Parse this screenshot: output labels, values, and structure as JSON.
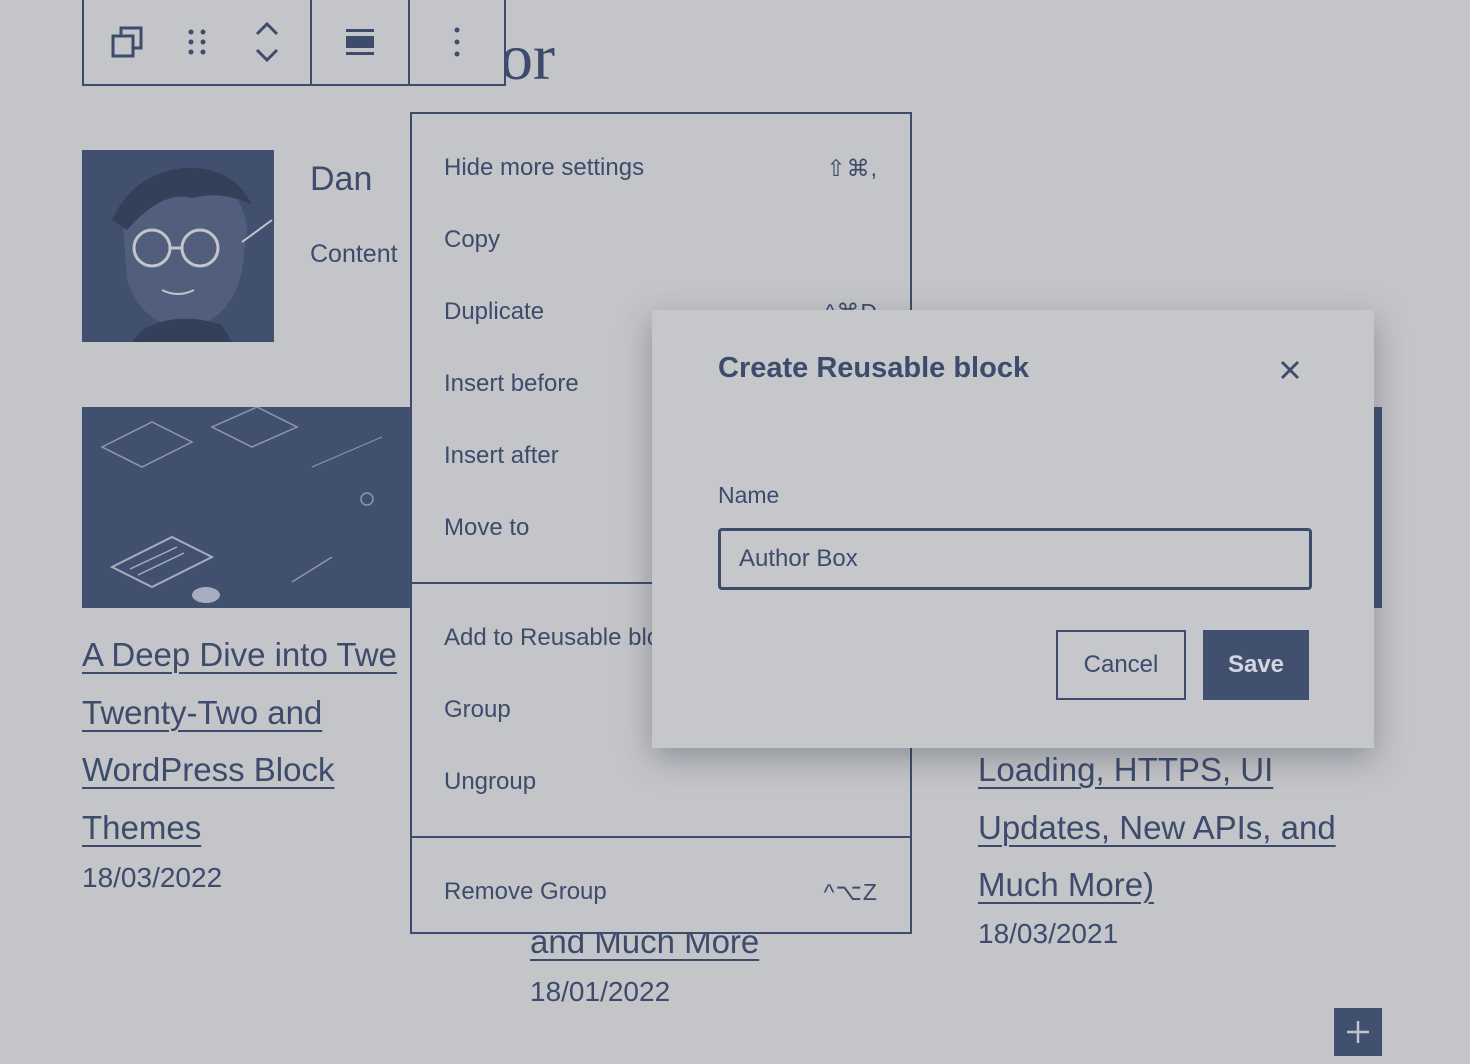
{
  "toolbar": {
    "transform_icon": "copy-squares-icon",
    "drag_icon": "drag-handle-icon",
    "move_icon": "chevron-up-down-icon",
    "align_icon": "align-justify-icon",
    "options_icon": "more-vertical-icon"
  },
  "page": {
    "heading_fragment": "or",
    "author": {
      "name": "Dan",
      "bio": "Content"
    },
    "posts": [
      {
        "title_lines": [
          "A Deep Dive into Twe",
          "Twenty-Two and",
          "WordPress Block",
          "Themes"
        ],
        "date": "18/03/2022"
      },
      {
        "title_lines": [
          "and Much More"
        ],
        "date": "18/01/2022"
      },
      {
        "title_lines": [
          "Loading, HTTPS, UI",
          "Updates, New APIs, and",
          "Much More)"
        ],
        "date": "18/03/2021"
      }
    ]
  },
  "menu": {
    "sections": [
      {
        "items": [
          {
            "label": "Hide more settings",
            "shortcut": "⇧⌘,"
          },
          {
            "label": "Copy",
            "shortcut": ""
          },
          {
            "label": "Duplicate",
            "shortcut": "^⌘D"
          },
          {
            "label": "Insert before",
            "shortcut": ""
          },
          {
            "label": "Insert after",
            "shortcut": ""
          },
          {
            "label": "Move to",
            "shortcut": ""
          }
        ]
      },
      {
        "items": [
          {
            "label": "Add to Reusable blocks",
            "shortcut": ""
          },
          {
            "label": "Group",
            "shortcut": ""
          },
          {
            "label": "Ungroup",
            "shortcut": ""
          }
        ]
      },
      {
        "items": [
          {
            "label": "Remove Group",
            "shortcut": "^⌥Z"
          }
        ]
      }
    ]
  },
  "modal": {
    "title": "Create Reusable block",
    "close_icon": "close-icon",
    "name_label": "Name",
    "name_value": "Author Box",
    "cancel_label": "Cancel",
    "save_label": "Save"
  },
  "inserter": {
    "icon": "plus-icon"
  },
  "colors": {
    "background": "#c4c5c8",
    "ink": "#3d4b6c",
    "primary": "#42506f"
  }
}
